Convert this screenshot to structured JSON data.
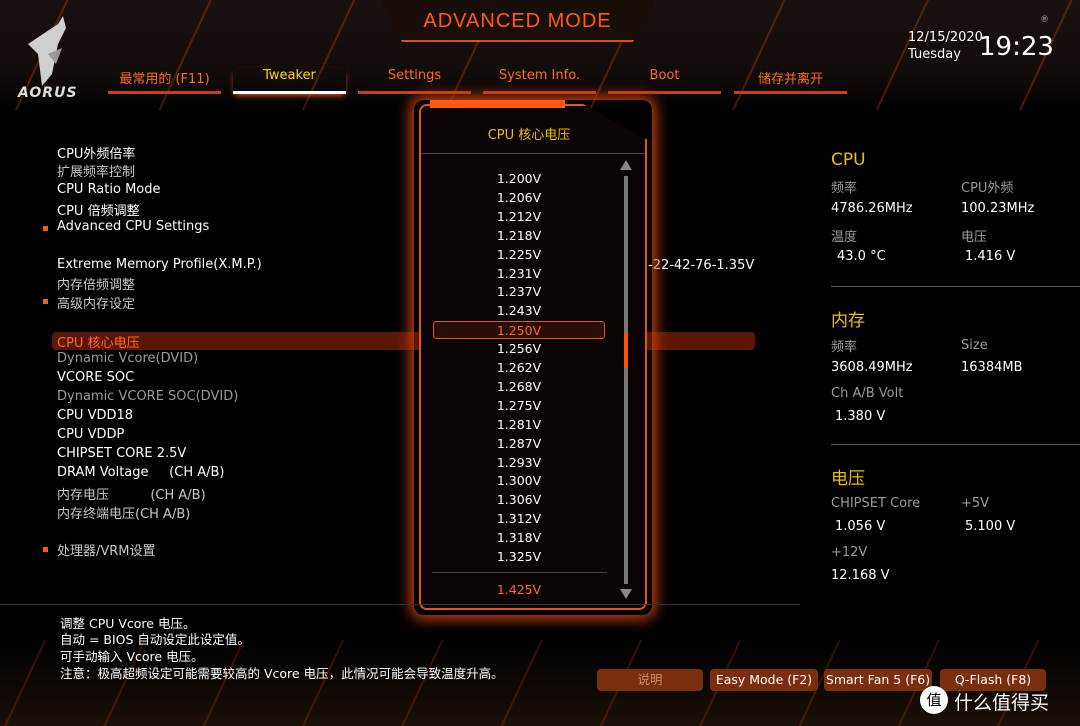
{
  "header": {
    "mode_title": "ADVANCED MODE",
    "logo_text": "AORUS",
    "date": "12/15/2020",
    "day": "Tuesday",
    "time": "19:23",
    "registered_mark": "®"
  },
  "tabs": [
    {
      "label": "最常用的 (F11)",
      "active": false
    },
    {
      "label": "Tweaker",
      "active": true
    },
    {
      "label": "Settings",
      "active": false
    },
    {
      "label": "System Info.",
      "active": false
    },
    {
      "label": "Boot",
      "active": false
    },
    {
      "label": "储存并离开",
      "active": false
    }
  ],
  "settings": {
    "cpu_clock_ratio": "CPU外频倍率",
    "ext_freq_control": "扩展频率控制",
    "cpu_ratio_mode": "CPU Ratio Mode",
    "cpu_ratio_adjust": "CPU 倍频调整",
    "advanced_cpu": "Advanced CPU Settings",
    "xmp": "Extreme Memory Profile(X.M.P.)",
    "xmp_value": "-22-42-76-1.35V",
    "mem_ratio": "内存倍频调整",
    "adv_mem": "高级内存设定",
    "cpu_vcore": "CPU 核心电压",
    "dynamic_vcore": "Dynamic Vcore(DVID)",
    "vcore_soc": "VCORE SOC",
    "dynamic_vcore_soc": "Dynamic VCORE SOC(DVID)",
    "cpu_vdd18": "CPU VDD18",
    "cpu_vddp": "CPU VDDP",
    "chipset_core": "CHIPSET CORE 2.5V",
    "dram_voltage": "DRAM Voltage     (CH A/B)",
    "mem_voltage": "内存电压          (CH A/B)",
    "mem_term_voltage": "内存终端电压(CH A/B)",
    "cpu_vrm": "处理器/VRM设置"
  },
  "popup": {
    "title": "CPU 核心电压",
    "options": [
      "1.200V",
      "1.206V",
      "1.212V",
      "1.218V",
      "1.225V",
      "1.231V",
      "1.237V",
      "1.243V",
      "1.250V",
      "1.256V",
      "1.262V",
      "1.268V",
      "1.275V",
      "1.281V",
      "1.287V",
      "1.293V",
      "1.300V",
      "1.306V",
      "1.312V",
      "1.318V",
      "1.325V"
    ],
    "selected": "1.250V",
    "current": "1.425V",
    "scroll_position_fraction": 0.42
  },
  "monitor": {
    "cpu": {
      "heading": "CPU",
      "freq_label": "频率",
      "freq": "4786.26MHz",
      "bclk_label": "CPU外频",
      "bclk": "100.23MHz",
      "temp_label": "温度",
      "temp": "43.0 °C",
      "volt_label": "电压",
      "volt": "1.416 V"
    },
    "memory": {
      "heading": "内存",
      "freq_label": "频率",
      "freq": "3608.49MHz",
      "size_label": "Size",
      "size": "16384MB",
      "volt_label": "Ch A/B Volt",
      "volt": "1.380 V"
    },
    "voltage": {
      "heading": "电压",
      "chipset_label": "CHIPSET Core",
      "chipset": "1.056 V",
      "p5_label": "+5V",
      "p5": "5.100 V",
      "p12_label": "+12V",
      "p12": "12.168 V"
    }
  },
  "help": [
    "调整 CPU Vcore 电压。",
    "自动 = BIOS 自动设定此设定值。",
    "可手动输入 Vcore 电压。",
    "注意：极高超频设定可能需要较高的 Vcore 电压，此情况可能会导致温度升高。"
  ],
  "buttons": {
    "help": "说明",
    "easy_mode": "Easy Mode (F2)",
    "smart_fan": "Smart Fan 5 (F6)",
    "qflash": "Q-Flash (F8)"
  },
  "watermark": {
    "badge": "值",
    "text": "什么值得买"
  },
  "colors": {
    "accent": "#ff5a10",
    "heading": "#e8c000",
    "highlight_bar": "#5a1606"
  }
}
